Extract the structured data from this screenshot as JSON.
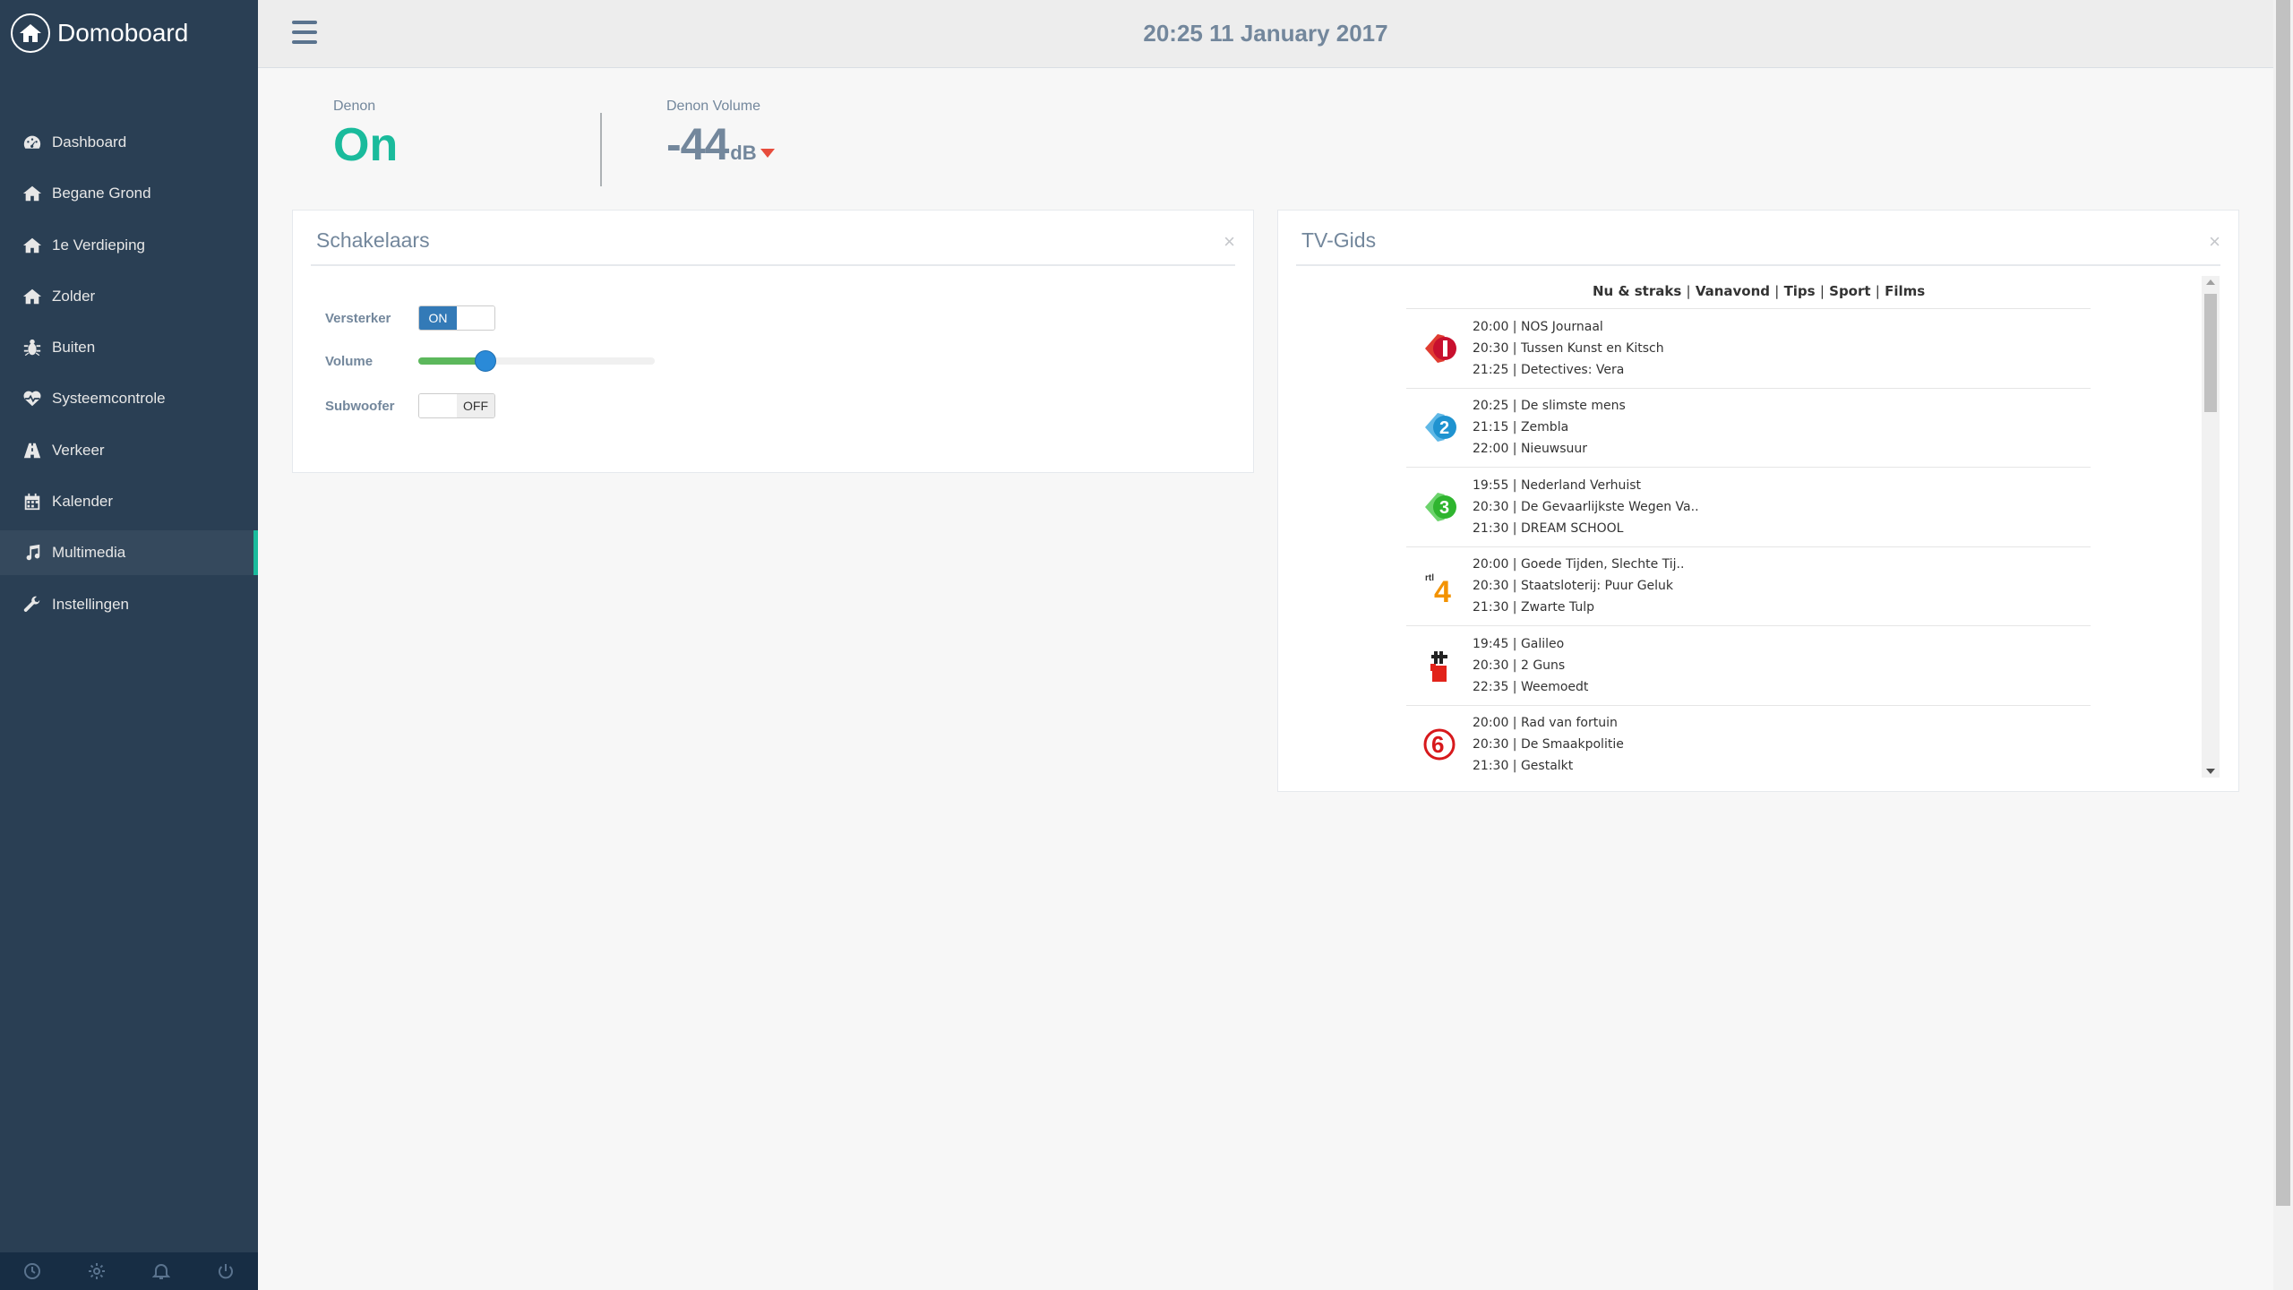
{
  "app": {
    "title": "Domoboard"
  },
  "sidebar": {
    "items": [
      {
        "label": "Dashboard",
        "icon": "dashboard-icon"
      },
      {
        "label": "Begane Grond",
        "icon": "home-icon"
      },
      {
        "label": "1e Verdieping",
        "icon": "home-icon"
      },
      {
        "label": "Zolder",
        "icon": "home-icon"
      },
      {
        "label": "Buiten",
        "icon": "bug-icon"
      },
      {
        "label": "Systeemcontrole",
        "icon": "heartbeat-icon"
      },
      {
        "label": "Verkeer",
        "icon": "road-icon"
      },
      {
        "label": "Kalender",
        "icon": "calendar-icon"
      },
      {
        "label": "Multimedia",
        "icon": "music-icon",
        "active": true
      },
      {
        "label": "Instellingen",
        "icon": "wrench-icon"
      }
    ],
    "footer": [
      "clock-icon",
      "gear-icon",
      "bell-icon",
      "power-icon"
    ]
  },
  "header": {
    "clock": "20:25 11 January 2017"
  },
  "tiles": {
    "denon": {
      "label": "Denon",
      "value": "On"
    },
    "volume": {
      "label": "Denon Volume",
      "value": "-44",
      "unit": "dB"
    }
  },
  "switches_panel": {
    "title": "Schakelaars",
    "close": "×",
    "rows": {
      "versterker": {
        "label": "Versterker",
        "state": "ON"
      },
      "volume": {
        "label": "Volume",
        "level": 0.27
      },
      "subwoofer": {
        "label": "Subwoofer",
        "state": "OFF"
      }
    }
  },
  "tv_panel": {
    "title": "TV-Gids",
    "close": "×",
    "nav": [
      "Nu & straks",
      "Vanavond",
      "Tips",
      "Sport",
      "Films"
    ],
    "separator": "|",
    "channels": [
      {
        "name": "NPO 1",
        "programs": [
          "20:00 | NOS Journaal",
          "20:30 | Tussen Kunst en Kitsch",
          "21:25 | Detectives: Vera"
        ]
      },
      {
        "name": "NPO 2",
        "programs": [
          "20:25 | De slimste mens",
          "21:15 | Zembla",
          "22:00 | Nieuwsuur"
        ]
      },
      {
        "name": "NPO 3",
        "programs": [
          "19:55 | Nederland Verhuist",
          "20:30 | De Gevaarlijkste Wegen Va..",
          "21:30 | DREAM SCHOOL"
        ]
      },
      {
        "name": "RTL 4",
        "programs": [
          "20:00 | Goede Tijden, Slechte Tij..",
          "20:30 | Staatsloterij: Puur Geluk",
          "21:30 | Zwarte Tulp"
        ]
      },
      {
        "name": "RTL 5",
        "programs": [
          "19:45 | Galileo",
          "20:30 | 2 Guns",
          "22:35 | Weemoedt"
        ]
      },
      {
        "name": "SBS 6",
        "programs": [
          "20:00 | Rad van fortuin",
          "20:30 | De Smaakpolitie",
          "21:30 | Gestalkt"
        ]
      }
    ]
  }
}
